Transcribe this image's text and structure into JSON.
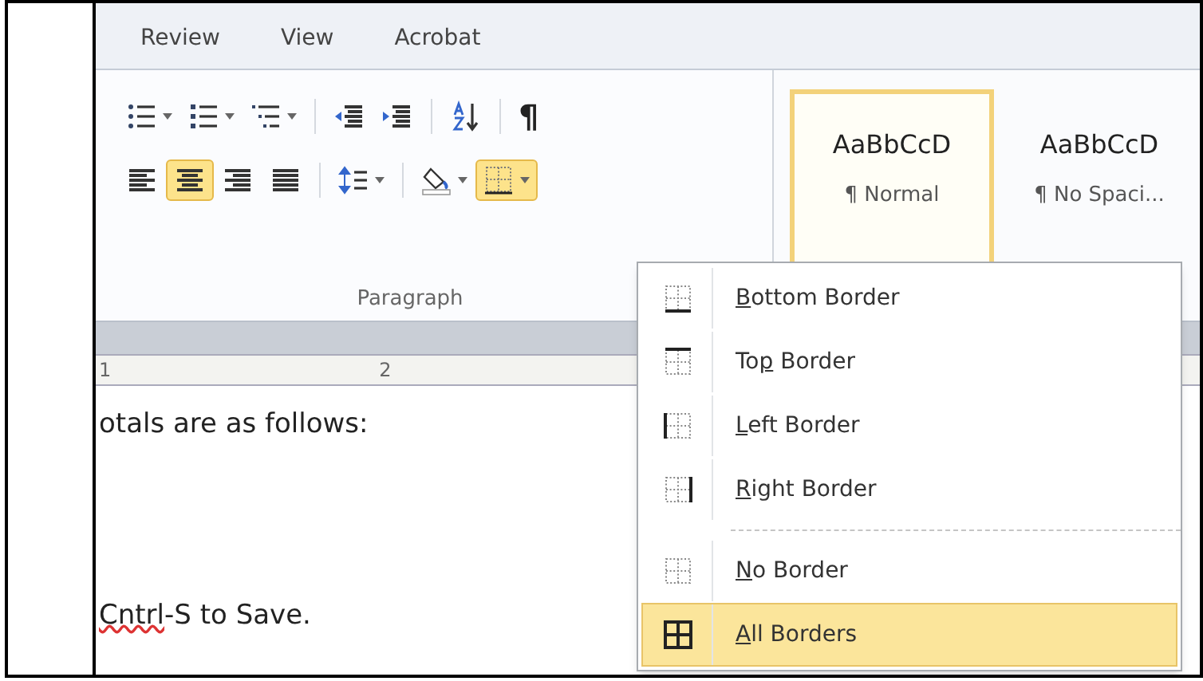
{
  "tabs": [
    {
      "label": "Review"
    },
    {
      "label": "View"
    },
    {
      "label": "Acrobat"
    }
  ],
  "paragraph_group": {
    "label": "Paragraph",
    "row_1": [
      {
        "kind": "bullets",
        "dropdown": true,
        "selected": false
      },
      {
        "kind": "numbering",
        "dropdown": true,
        "selected": false
      },
      {
        "kind": "multilevel",
        "dropdown": true,
        "selected": false
      },
      {
        "kind": "sep"
      },
      {
        "kind": "outdent",
        "dropdown": false,
        "selected": false
      },
      {
        "kind": "indent",
        "dropdown": false,
        "selected": false
      },
      {
        "kind": "sep"
      },
      {
        "kind": "sort",
        "dropdown": false,
        "selected": false
      },
      {
        "kind": "sep"
      },
      {
        "kind": "marks",
        "glyph": "¶",
        "dropdown": false,
        "selected": false
      }
    ],
    "row_2": [
      {
        "kind": "align-left",
        "dropdown": false,
        "selected": false
      },
      {
        "kind": "align-center",
        "dropdown": false,
        "selected": true
      },
      {
        "kind": "align-right",
        "dropdown": false,
        "selected": false
      },
      {
        "kind": "justify",
        "dropdown": false,
        "selected": false
      },
      {
        "kind": "sep"
      },
      {
        "kind": "line-spacing",
        "dropdown": true,
        "selected": false
      },
      {
        "kind": "sep"
      },
      {
        "kind": "shading",
        "dropdown": true,
        "selected": false
      },
      {
        "kind": "borders",
        "dropdown": true,
        "selected": true
      }
    ]
  },
  "styles": [
    {
      "preview": "AaBbCcD",
      "name": "¶ Normal",
      "selected": true
    },
    {
      "preview": "AaBbCcD",
      "name": "¶ No Spaci...",
      "selected": false
    }
  ],
  "ruler": {
    "numbers": [
      "1",
      "2"
    ]
  },
  "document": [
    [
      {
        "text": "otals are as follows:",
        "misspelled": false
      }
    ],
    [
      {
        "text": "Cntrl",
        "misspelled": true
      },
      {
        "text": "-S to Save.",
        "misspelled": false
      }
    ]
  ],
  "borders_menu": [
    {
      "kind": "bottom",
      "label": [
        {
          "text": "B",
          "underlined": true
        },
        {
          "text": "ottom Border",
          "underlined": false
        }
      ],
      "selected": false
    },
    {
      "kind": "top",
      "label": [
        {
          "text": "To",
          "underlined": false
        },
        {
          "text": "p",
          "underlined": true
        },
        {
          "text": " Border",
          "underlined": false
        }
      ],
      "selected": false
    },
    {
      "kind": "left",
      "label": [
        {
          "text": "L",
          "underlined": true
        },
        {
          "text": "eft Border",
          "underlined": false
        }
      ],
      "selected": false
    },
    {
      "kind": "right",
      "label": [
        {
          "text": "R",
          "underlined": true
        },
        {
          "text": "ight Border",
          "underlined": false
        }
      ],
      "selected": false
    },
    {
      "kind": "separator"
    },
    {
      "kind": "none",
      "label": [
        {
          "text": "N",
          "underlined": true
        },
        {
          "text": "o Border",
          "underlined": false
        }
      ],
      "selected": false
    },
    {
      "kind": "all",
      "label": [
        {
          "text": "A",
          "underlined": true
        },
        {
          "text": "ll Borders",
          "underlined": false
        }
      ],
      "selected": true
    }
  ]
}
